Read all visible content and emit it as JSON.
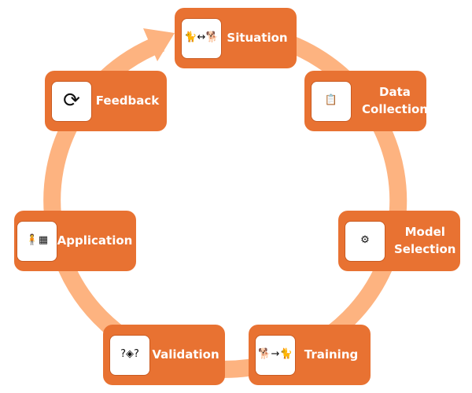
{
  "colors": {
    "box": "#E87232",
    "ring": "#FDB380",
    "icon_bg": "#FFFFFF",
    "text": "#FFFFFF"
  },
  "steps": [
    {
      "label": "Situation",
      "icon": "cat-dog-icon",
      "glyph": "🐈↔🐕"
    },
    {
      "label": "Data Collection",
      "icon": "clipboard-icon",
      "glyph": "📋"
    },
    {
      "label": "Model Selection",
      "icon": "model-network-icon",
      "glyph": "⚙"
    },
    {
      "label": "Training",
      "icon": "dog-to-cat-icon",
      "glyph": "🐕→🐈"
    },
    {
      "label": "Validation",
      "icon": "validation-chip-icon",
      "glyph": "?◈?"
    },
    {
      "label": "Application",
      "icon": "application-person-icon",
      "glyph": "🧍▦"
    },
    {
      "label": "Feedback",
      "icon": "feedback-cycle-icon",
      "glyph": "⟳"
    }
  ]
}
